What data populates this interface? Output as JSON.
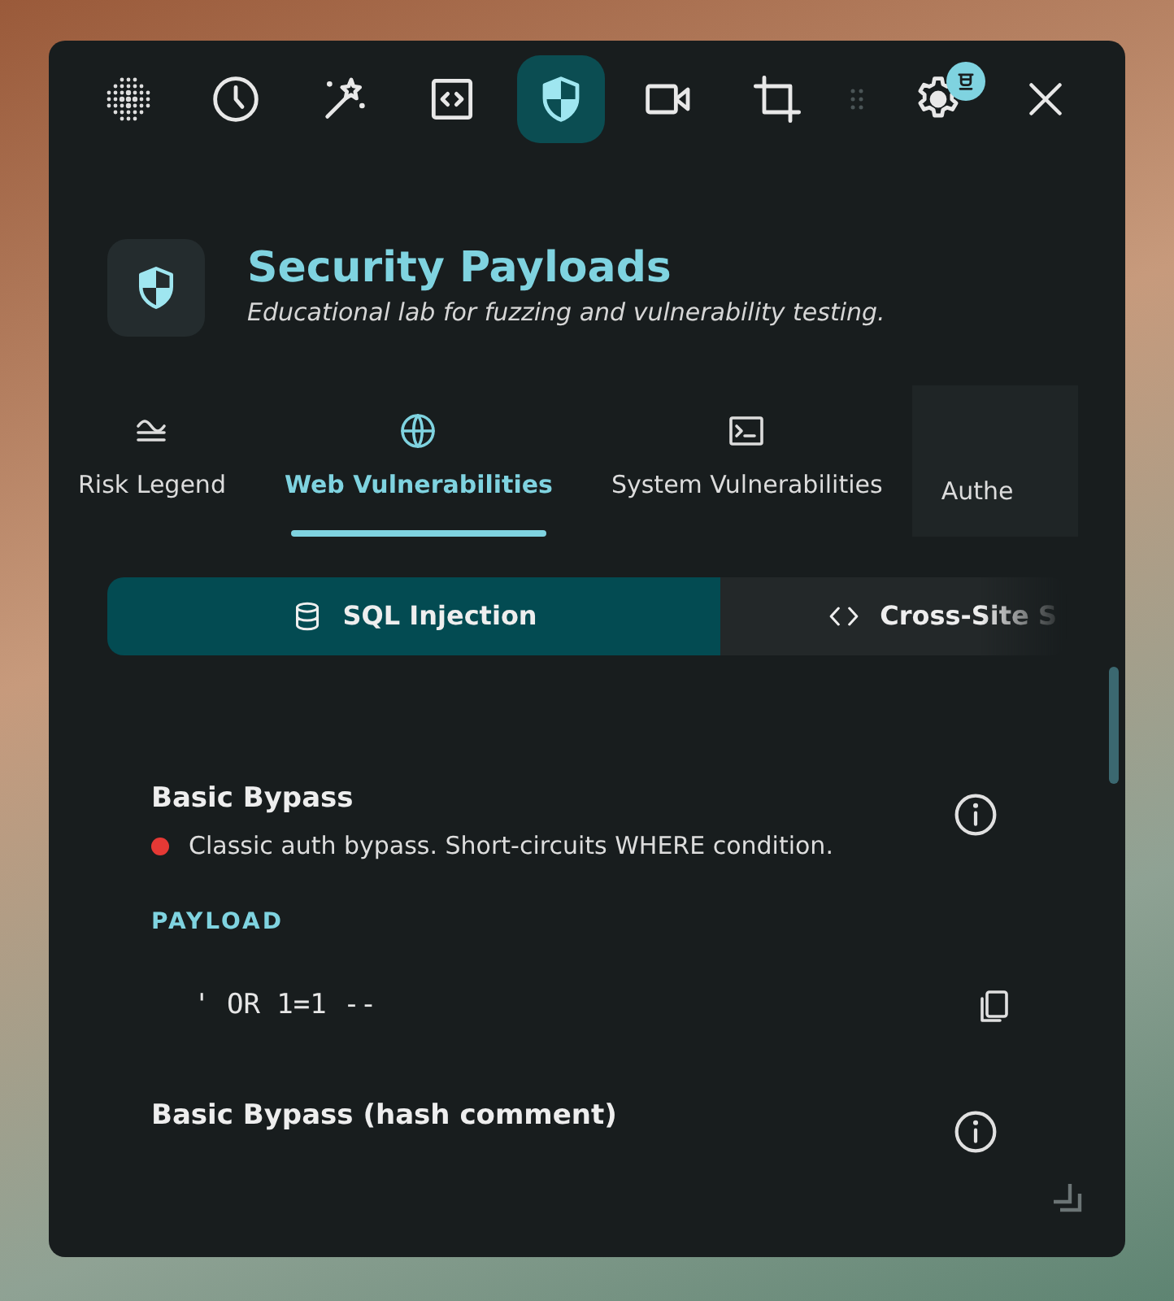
{
  "toolbar": [
    {
      "kind": "dots",
      "selected": false
    },
    {
      "kind": "clock",
      "selected": false
    },
    {
      "kind": "wand",
      "selected": false
    },
    {
      "kind": "code",
      "selected": false
    },
    {
      "kind": "shield",
      "selected": true
    },
    {
      "kind": "video",
      "selected": false
    },
    {
      "kind": "crop",
      "selected": false
    },
    {
      "kind": "handle",
      "selected": false
    },
    {
      "kind": "gear",
      "selected": false,
      "badge": true
    },
    {
      "kind": "close",
      "selected": false
    }
  ],
  "header": {
    "title": "Security Payloads",
    "subtitle": "Educational lab for fuzzing and vulnerability testing."
  },
  "tabs": [
    {
      "kind": "lines",
      "label": "Risk Legend",
      "selected": false
    },
    {
      "kind": "globe",
      "label": "Web Vulnerabilities",
      "selected": true
    },
    {
      "kind": "terminal",
      "label": "System Vulnerabilities",
      "selected": false
    },
    {
      "kind": "plain",
      "label": "Authe",
      "selected": false
    }
  ],
  "subtabs": [
    {
      "kind": "database",
      "label": "SQL Injection",
      "selected": true
    },
    {
      "kind": "code",
      "label": "Cross-Site S",
      "selected": false
    }
  ],
  "payloads": [
    {
      "title": "Basic Bypass",
      "color": "#e53935",
      "description": "Classic auth bypass. Short-circuits WHERE condition.",
      "payload_label": "PAYLOAD",
      "payload": "' OR 1=1 --"
    },
    {
      "title": "Basic Bypass (hash comment)"
    }
  ]
}
